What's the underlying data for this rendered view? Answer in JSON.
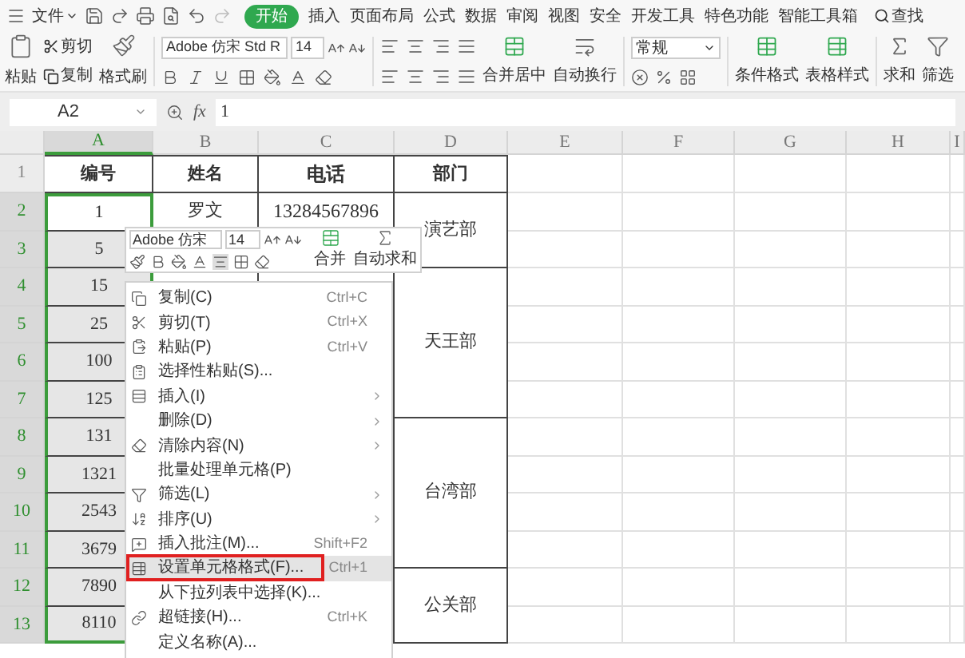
{
  "menu_bar": {
    "file_menu": "文件",
    "tabs": [
      {
        "label": "开始",
        "selected": true
      },
      {
        "label": "插入",
        "selected": false
      },
      {
        "label": "页面布局",
        "selected": false
      },
      {
        "label": "公式",
        "selected": false
      },
      {
        "label": "数据",
        "selected": false
      },
      {
        "label": "审阅",
        "selected": false
      },
      {
        "label": "视图",
        "selected": false
      },
      {
        "label": "安全",
        "selected": false
      },
      {
        "label": "开发工具",
        "selected": false
      },
      {
        "label": "特色功能",
        "selected": false
      },
      {
        "label": "智能工具箱",
        "selected": false
      }
    ],
    "search": "查找"
  },
  "ribbon": {
    "paste": "粘贴",
    "cut": "剪切",
    "copy": "复制",
    "format_painter": "格式刷",
    "font_name": "Adobe 仿宋 Std R",
    "font_size": "14",
    "merge": "合并居中",
    "wrap": "自动换行",
    "number_format": "常规",
    "conditional_format": "条件格式",
    "table_style": "表格样式",
    "sum": "求和",
    "filter": "筛选"
  },
  "formula_bar": {
    "name_box": "A2",
    "fx": "fx",
    "value": "1"
  },
  "columns": [
    {
      "label": "A",
      "selected": true
    },
    {
      "label": "B",
      "selected": false
    },
    {
      "label": "C",
      "selected": false
    },
    {
      "label": "D",
      "selected": false
    },
    {
      "label": "E",
      "selected": false
    },
    {
      "label": "F",
      "selected": false
    },
    {
      "label": "G",
      "selected": false
    },
    {
      "label": "H",
      "selected": false
    },
    {
      "label": "I",
      "selected": false
    }
  ],
  "rows": [
    {
      "number": "1",
      "kind": "header",
      "selected": false,
      "active": false,
      "a": "编号",
      "b": "姓名",
      "c": "电话",
      "dept": "部门"
    },
    {
      "number": "2",
      "kind": "data",
      "selected": true,
      "active": true,
      "a": "1",
      "b": "罗文",
      "c": "13284567896",
      "dept": "演艺部"
    },
    {
      "number": "3",
      "kind": "data",
      "selected": true,
      "active": false,
      "a": "5"
    },
    {
      "number": "4",
      "kind": "data",
      "selected": true,
      "active": false,
      "a": "15",
      "dept": "天王部"
    },
    {
      "number": "5",
      "kind": "data",
      "selected": true,
      "active": false,
      "a": "25"
    },
    {
      "number": "6",
      "kind": "data",
      "selected": true,
      "active": false,
      "a": "100"
    },
    {
      "number": "7",
      "kind": "data",
      "selected": true,
      "active": false,
      "a": "125"
    },
    {
      "number": "8",
      "kind": "data",
      "selected": true,
      "active": false,
      "a": "131",
      "dept": "台湾部"
    },
    {
      "number": "9",
      "kind": "data",
      "selected": true,
      "active": false,
      "a": "1321"
    },
    {
      "number": "10",
      "kind": "data",
      "selected": true,
      "active": false,
      "a": "2543"
    },
    {
      "number": "11",
      "kind": "data",
      "selected": true,
      "active": false,
      "a": "3679"
    },
    {
      "number": "12",
      "kind": "data",
      "selected": true,
      "active": false,
      "a": "7890",
      "dept": "公关部"
    },
    {
      "number": "13",
      "kind": "data",
      "selected": true,
      "active": false,
      "a": "8110"
    }
  ],
  "mini_toolbar": {
    "font_name": "Adobe 仿宋",
    "font_size": "14",
    "merge": "合并",
    "autosum": "自动求和"
  },
  "context_menu": {
    "items": [
      {
        "label": "复制(C)",
        "shortcut": "Ctrl+C",
        "submenu": false,
        "selected": false,
        "annotated": false
      },
      {
        "label": "剪切(T)",
        "shortcut": "Ctrl+X",
        "submenu": false,
        "selected": false,
        "annotated": false
      },
      {
        "label": "粘贴(P)",
        "shortcut": "Ctrl+V",
        "submenu": false,
        "selected": false,
        "annotated": false
      },
      {
        "label": "选择性粘贴(S)...",
        "submenu": false,
        "selected": false,
        "annotated": false
      },
      {
        "label": "插入(I)",
        "submenu": true,
        "selected": false,
        "annotated": false
      },
      {
        "label": "删除(D)",
        "submenu": true,
        "selected": false,
        "annotated": false
      },
      {
        "label": "清除内容(N)",
        "submenu": true,
        "selected": false,
        "annotated": false
      },
      {
        "label": "批量处理单元格(P)",
        "submenu": false,
        "selected": false,
        "annotated": false
      },
      {
        "label": "筛选(L)",
        "submenu": true,
        "selected": false,
        "annotated": false
      },
      {
        "label": "排序(U)",
        "submenu": true,
        "selected": false,
        "annotated": false
      },
      {
        "label": "插入批注(M)...",
        "shortcut": "Shift+F2",
        "submenu": false,
        "selected": false,
        "annotated": false
      },
      {
        "label": "设置单元格格式(F)...",
        "shortcut": "Ctrl+1",
        "submenu": false,
        "selected": true,
        "annotated": true
      },
      {
        "label": "从下拉列表中选择(K)...",
        "submenu": false,
        "selected": false,
        "annotated": false
      },
      {
        "label": "超链接(H)...",
        "shortcut": "Ctrl+K",
        "submenu": false,
        "selected": false,
        "annotated": false
      },
      {
        "label": "定义名称(A)...",
        "submenu": false,
        "selected": false,
        "annotated": false
      }
    ]
  }
}
